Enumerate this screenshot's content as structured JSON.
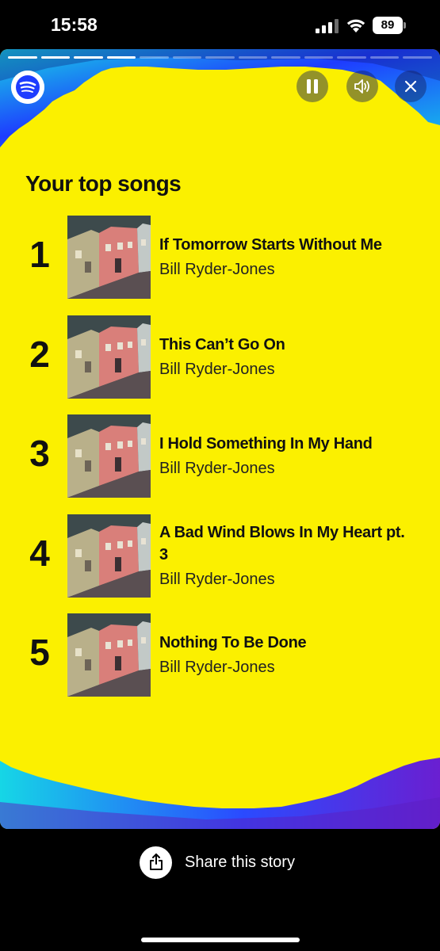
{
  "status_bar": {
    "time": "15:58",
    "battery": "89",
    "icons": [
      "signal-icon",
      "wifi-icon",
      "battery-icon"
    ]
  },
  "story": {
    "progress": {
      "total_segments": 13,
      "completed_segments": 4
    },
    "controls": [
      "spotify-logo",
      "pause-icon",
      "speaker-icon",
      "close-icon"
    ],
    "colors": {
      "background": "#fbf000",
      "accent_blue": "#1e3cff",
      "accent_cyan": "#16d6e6",
      "accent_purple": "#6a1fd1"
    },
    "title": "Your top songs",
    "songs": [
      {
        "rank": "1",
        "title": "If Tomorrow Starts Without Me",
        "artist": "Bill Ryder-Jones"
      },
      {
        "rank": "2",
        "title": "This Can’t Go On",
        "artist": "Bill Ryder-Jones"
      },
      {
        "rank": "3",
        "title": "I Hold Something In My Hand",
        "artist": "Bill Ryder-Jones"
      },
      {
        "rank": "4",
        "title": "A Bad Wind Blows In My Heart pt. 3",
        "artist": "Bill Ryder-Jones"
      },
      {
        "rank": "5",
        "title": "Nothing To Be Done",
        "artist": "Bill Ryder-Jones"
      }
    ]
  },
  "share": {
    "label": "Share this story"
  }
}
